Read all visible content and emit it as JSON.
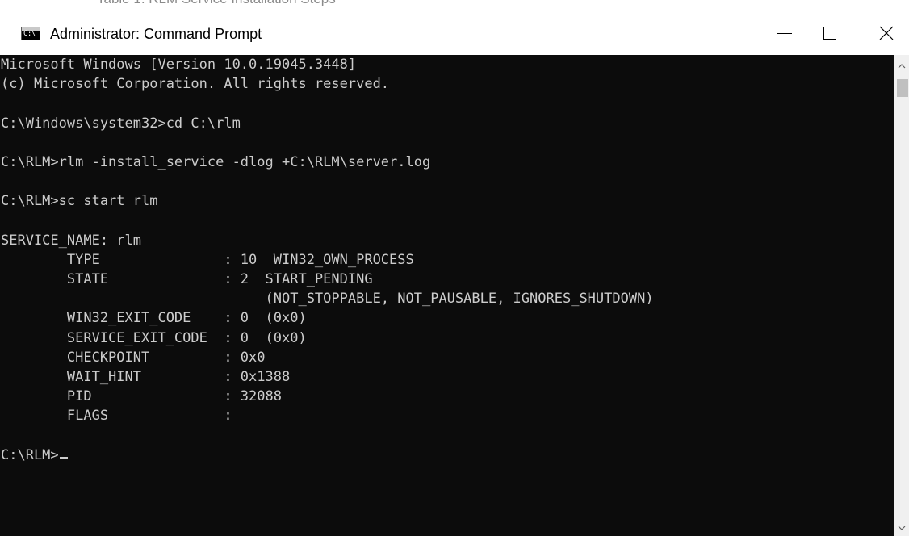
{
  "background_window": {
    "partial_text": "Table 1: RLM Service Installation Steps"
  },
  "window": {
    "title": "Administrator: Command Prompt",
    "app_icon": "cmd-icon",
    "app_icon_label": "C:\\",
    "controls": {
      "minimize": "minimize-icon",
      "maximize": "maximize-icon",
      "close": "close-icon"
    }
  },
  "console": {
    "colors": {
      "background": "#0c0c0c",
      "foreground": "#cccccc"
    },
    "lines": [
      "Microsoft Windows [Version 10.0.19045.3448]",
      "(c) Microsoft Corporation. All rights reserved.",
      "",
      "C:\\Windows\\system32>cd C:\\rlm",
      "",
      "C:\\RLM>rlm -install_service -dlog +C:\\RLM\\server.log",
      "",
      "C:\\RLM>sc start rlm",
      "",
      "SERVICE_NAME: rlm",
      "        TYPE               : 10  WIN32_OWN_PROCESS",
      "        STATE              : 2  START_PENDING",
      "                                (NOT_STOPPABLE, NOT_PAUSABLE, IGNORES_SHUTDOWN)",
      "        WIN32_EXIT_CODE    : 0  (0x0)",
      "        SERVICE_EXIT_CODE  : 0  (0x0)",
      "        CHECKPOINT         : 0x0",
      "        WAIT_HINT          : 0x1388",
      "        PID                : 32088",
      "        FLAGS              :",
      ""
    ],
    "prompt": "C:\\RLM>"
  },
  "scrollbar": {
    "up_icon": "chevron-up-icon",
    "down_icon": "chevron-down-icon"
  }
}
